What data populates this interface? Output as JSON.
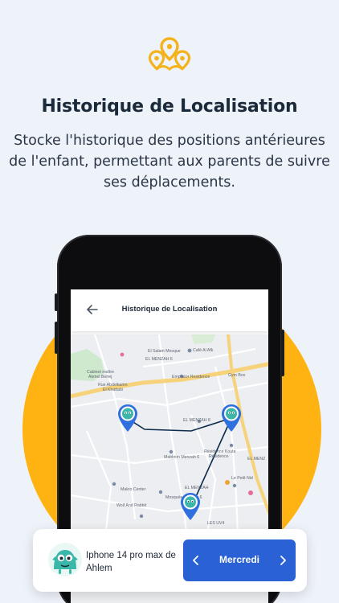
{
  "header": {
    "title": "Historique de Localisation",
    "description_lines": [
      "Stocke l'historique des positions antérieures",
      "de l'enfant, permettant aux parents de suivre",
      "ses déplacements."
    ]
  },
  "app": {
    "screen_title": "Historique de Localisation",
    "map_labels": [
      "El Salam Mosque",
      "Café Al Afk",
      "EL MENZAH 6",
      "Cabinet maître",
      "Akmel Bertej",
      "Rue Abdelkarim",
      "El Khattabi",
      "Emprator Residence",
      "Gym Box",
      "EL MENZAH 8",
      "Résidence Koute",
      "Résidence",
      "Mabkrim Menzah 6",
      "EL MENZ",
      "Makro Center",
      "Mosquée Menzah 6",
      "EL MENZAH",
      "Wolf And Rabbit",
      "Le Petit Nid",
      "LES UV4"
    ]
  },
  "card": {
    "device_name": "Iphone 14 pro max de Ahlem",
    "day": "Mercredi",
    "prev_icon": "chevron-left-icon",
    "next_icon": "chevron-right-icon"
  },
  "colors": {
    "background": "#eef2f9",
    "accent_orange": "#ffb312",
    "primary_blue": "#2a62d6",
    "marker_blue": "#2f6fde",
    "logo_yellow": "#f5b31b"
  }
}
